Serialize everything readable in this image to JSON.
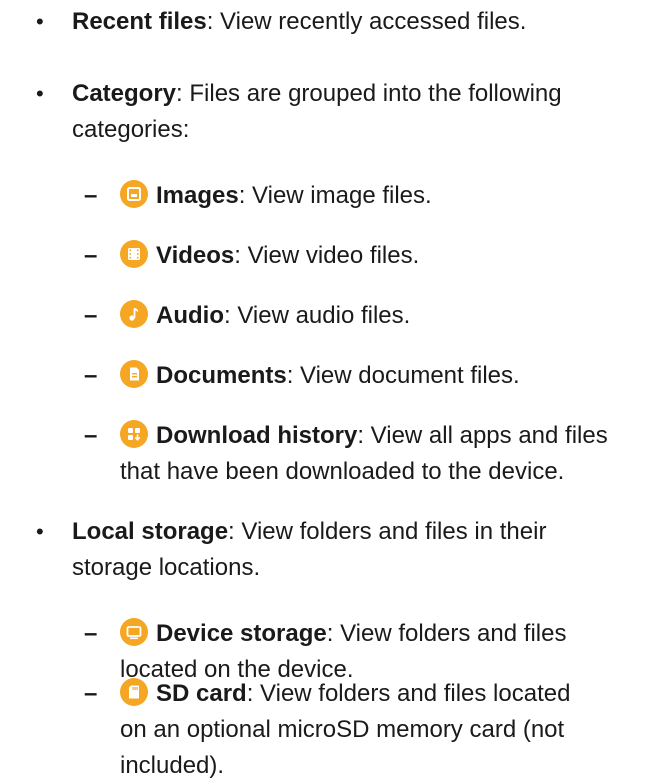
{
  "accent_color": "#f5a623",
  "bullets": {
    "recent": {
      "mark": "•",
      "title": "Recent files",
      "desc": ": View recently accessed files."
    },
    "category": {
      "mark": "•",
      "title": "Category",
      "desc_line1": ": Files are grouped into the following",
      "desc_line2": "categories:"
    },
    "local": {
      "mark": "•",
      "title": "Local storage",
      "desc_line1": ": View folders and files in their",
      "desc_line2": "storage locations."
    }
  },
  "category_items": [
    {
      "mark": "–",
      "icon": "image-icon",
      "title": "Images",
      "desc": ": View image files."
    },
    {
      "mark": "–",
      "icon": "video-icon",
      "title": "Videos",
      "desc": ": View video files."
    },
    {
      "mark": "–",
      "icon": "audio-icon",
      "title": "Audio",
      "desc": ": View audio files."
    },
    {
      "mark": "–",
      "icon": "document-icon",
      "title": "Documents",
      "desc": ": View document files."
    },
    {
      "mark": "–",
      "icon": "download-icon",
      "title": "Download history",
      "desc_line1": ": View all apps and files",
      "desc_line2": "that have been downloaded to the device."
    }
  ],
  "storage_items": [
    {
      "mark": "–",
      "icon": "device-storage-icon",
      "title": "Device storage",
      "desc_line1": ": View folders and files",
      "desc_line2": "located on the device."
    },
    {
      "mark": "–",
      "icon": "sd-card-icon",
      "title": "SD card",
      "desc_line1": ": View folders and files located",
      "desc_line2": "on an optional microSD memory card (not",
      "desc_line3": "included)."
    }
  ]
}
